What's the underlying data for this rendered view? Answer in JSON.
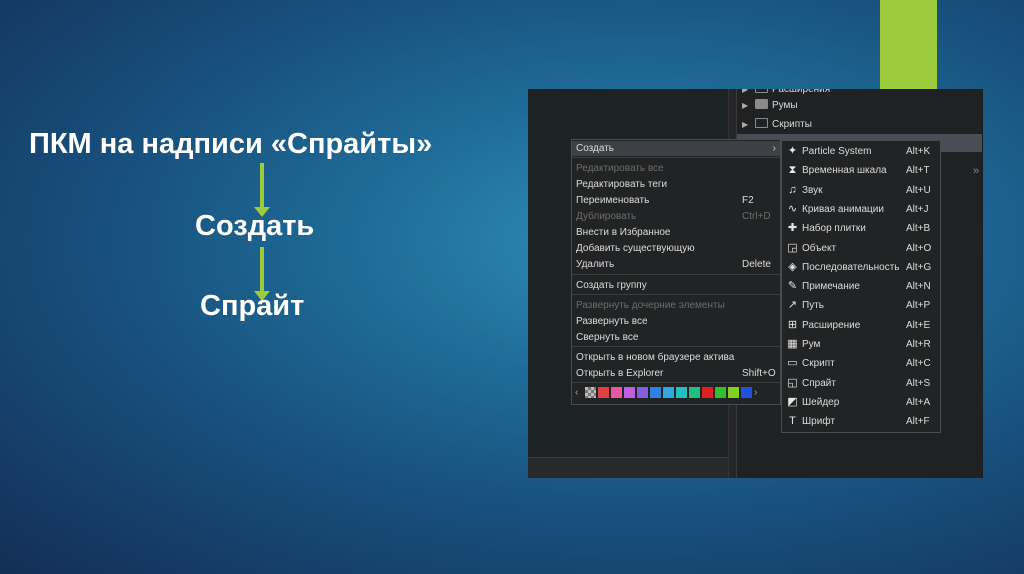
{
  "slide": {
    "line1": "ПКМ на надписи «Спрайты»",
    "line2": "Создать",
    "line3": "Спрайт",
    "accent_color": "#9ccc3c"
  },
  "tree": [
    {
      "label": "Расширения",
      "folder": "outline"
    },
    {
      "label": "Румы",
      "folder": "filled"
    },
    {
      "label": "Скрипты",
      "folder": "outline"
    }
  ],
  "context_menu": [
    {
      "label": "Создать",
      "shortcut": "",
      "state": "highlight",
      "has_submenu": true
    },
    {
      "label": "Редактировать все",
      "shortcut": "",
      "state": "disabled"
    },
    {
      "label": "Редактировать теги",
      "shortcut": "",
      "state": "normal"
    },
    {
      "label": "Переименовать",
      "shortcut": "F2",
      "state": "normal"
    },
    {
      "label": "Дублировать",
      "shortcut": "Ctrl+D",
      "state": "disabled"
    },
    {
      "label": "Внести в Избранное",
      "shortcut": "",
      "state": "normal"
    },
    {
      "label": "Добавить существующую",
      "shortcut": "",
      "state": "normal"
    },
    {
      "label": "Удалить",
      "shortcut": "Delete",
      "state": "normal"
    },
    {
      "label": "Создать группу",
      "shortcut": "",
      "state": "normal"
    },
    {
      "label": "Развернуть дочерние элементы",
      "shortcut": "",
      "state": "disabled"
    },
    {
      "label": "Развернуть все",
      "shortcut": "",
      "state": "normal"
    },
    {
      "label": "Свернуть все",
      "shortcut": "",
      "state": "normal"
    },
    {
      "label": "Открыть в новом браузере актива",
      "shortcut": "",
      "state": "normal"
    },
    {
      "label": "Открыть в Explorer",
      "shortcut": "Shift+O",
      "state": "normal"
    }
  ],
  "swatches": [
    "checker",
    "#e04040",
    "#e858a0",
    "#c060e0",
    "#8060e0",
    "#3080e0",
    "#30a8e0",
    "#20c0c0",
    "#20c080",
    "#e02020",
    "#30c030",
    "#80d020",
    "#2050e0"
  ],
  "submenu": [
    {
      "label": "Particle System",
      "shortcut": "Alt+K",
      "icon": "particle-icon",
      "glyph": "✦"
    },
    {
      "label": "Временная шкала",
      "shortcut": "Alt+T",
      "icon": "hourglass-icon",
      "glyph": "⧗"
    },
    {
      "label": "Звук",
      "shortcut": "Alt+U",
      "icon": "sound-wave-icon",
      "glyph": "♫"
    },
    {
      "label": "Кривая анимации",
      "shortcut": "Alt+J",
      "icon": "curve-icon",
      "glyph": "∿"
    },
    {
      "label": "Набор плитки",
      "shortcut": "Alt+B",
      "icon": "tileset-icon",
      "glyph": "✚"
    },
    {
      "label": "Объект",
      "shortcut": "Alt+O",
      "icon": "object-icon",
      "glyph": "◲"
    },
    {
      "label": "Последовательность",
      "shortcut": "Alt+G",
      "icon": "sequence-icon",
      "glyph": "◈"
    },
    {
      "label": "Примечание",
      "shortcut": "Alt+N",
      "icon": "note-icon",
      "glyph": "✎"
    },
    {
      "label": "Путь",
      "shortcut": "Alt+P",
      "icon": "path-icon",
      "glyph": "↗"
    },
    {
      "label": "Расширение",
      "shortcut": "Alt+E",
      "icon": "extension-icon",
      "glyph": "⊞"
    },
    {
      "label": "Рум",
      "shortcut": "Alt+R",
      "icon": "room-icon",
      "glyph": "▦"
    },
    {
      "label": "Скрипт",
      "shortcut": "Alt+C",
      "icon": "script-icon",
      "glyph": "▭"
    },
    {
      "label": "Спрайт",
      "shortcut": "Alt+S",
      "icon": "sprite-icon",
      "glyph": "◱"
    },
    {
      "label": "Шейдер",
      "shortcut": "Alt+A",
      "icon": "shader-icon",
      "glyph": "◩"
    },
    {
      "label": "Шрифт",
      "shortcut": "Alt+F",
      "icon": "font-icon",
      "glyph": "T"
    }
  ]
}
